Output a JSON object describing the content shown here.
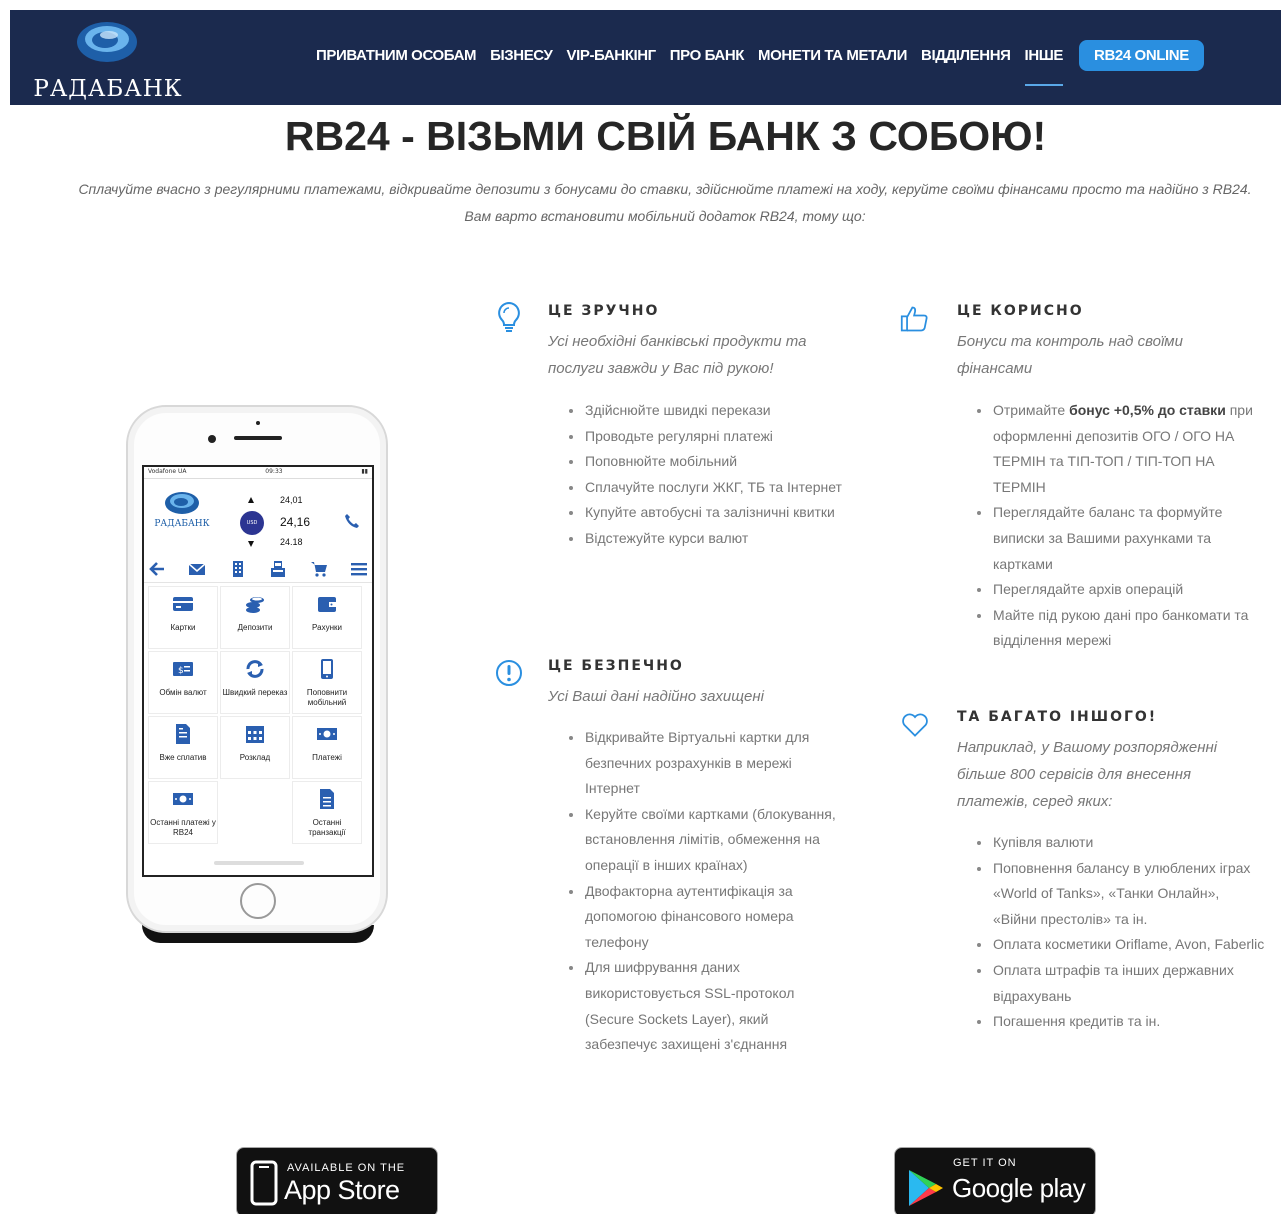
{
  "brand": {
    "name": "РАДАБАНК"
  },
  "nav": {
    "items": [
      {
        "label": "ПРИВАТНИМ ОСОБАМ",
        "name": "nav-private"
      },
      {
        "label": "БІЗНЕСУ",
        "name": "nav-business"
      },
      {
        "label": "VIP-БАНКІНГ",
        "name": "nav-vip"
      },
      {
        "label": "ПРО БАНК",
        "name": "nav-about"
      },
      {
        "label": "МОНЕТИ ТА МЕТАЛИ",
        "name": "nav-coins"
      },
      {
        "label": "ВІДДІЛЕННЯ",
        "name": "nav-branches"
      },
      {
        "label": "ІНШЕ",
        "name": "nav-other",
        "active": true
      }
    ],
    "cta_label": "RB24 ONLINE"
  },
  "hero": {
    "title": "RB24 - ВІЗЬМИ СВІЙ БАНК З СОБОЮ!",
    "subtitle": "Сплачуйте вчасно з регулярними платежами, відкривайте депозити з бонусами до ставки, здійснюйте платежі на ходу, керуйте своїми фінансами просто та надійно з RB24. Вам варто встановити мобільний додаток RB24, тому що:"
  },
  "phone": {
    "status_carrier": "Vodafone UA",
    "status_time": "09:33",
    "brand": "РАДАБАНК",
    "currency": "USD",
    "rate_buy": "24,01",
    "rate_main": "24,16",
    "rate_sell": "24.18",
    "tiles": [
      "Картки",
      "Депозити",
      "Рахунки",
      "Обмін валют",
      "Швидкий переказ",
      "Поповнити мобільний",
      "Вже сплатив",
      "Розклад",
      "Платежі",
      "Останні платежі у RB24",
      "",
      "Останні транзакції"
    ]
  },
  "features": {
    "convenient": {
      "title": "ЦЕ ЗРУЧНО",
      "lead": "Усі необхідні банківські продукти та послуги завжди у Вас під рукою!",
      "items": [
        "Здійснюйте швидкі перекази",
        "Проводьте регулярні платежі",
        "Поповнюйте мобільний",
        "Сплачуйте послуги ЖКГ, ТБ та Інтернет",
        "Купуйте автобусні та залізничні квитки",
        "Відстежуйте курси валют"
      ]
    },
    "useful": {
      "title": "ЦЕ КОРИСНО",
      "lead": "Бонуси та контроль над своїми фінансами",
      "item0_pre": "Отримайте ",
      "item0_bold": "бонус +0,5% до ставки",
      "item0_post": " при оформленні депозитів ОГО / ОГО НА ТЕРМІН та ТІП-ТОП / ТІП-ТОП НА ТЕРМІН",
      "items": [
        "Переглядайте баланс та формуйте виписки за Вашими рахунками та картками",
        "Переглядайте архів операцій",
        "Майте під рукою дані про банкомати та відділення мережі"
      ]
    },
    "secure": {
      "title": "ЦЕ БЕЗПЕЧНО",
      "lead": "Усі Ваші дані надійно захищені",
      "items": [
        "Відкривайте Віртуальні картки для безпечних розрахунків в мережі Інтернет",
        "Керуйте своїми картками (блокування, встановлення лімітів, обмеження на операції в інших країнах)",
        "Двофакторна аутентифікація за допомогою фінансового номера телефону",
        "Для шифрування даних використовується SSL-протокол (Secure Sockets Layer), який забезпечує захищені з'єднання"
      ]
    },
    "more": {
      "title": "ТА БАГАТО ІНШОГО!",
      "lead": "Наприклад, у Вашому розпорядженні більше 800 сервісів для внесення платежів, серед яких:",
      "items": [
        "Купівля валюти",
        "Поповнення балансу в улюблених іграх «World of Tanks», «Танки Онлайн», «Війни престолів» та ін.",
        "Оплата косметики Oriflame, Avon, Faberlic",
        "Оплата штрафів та інших державних відрахувань",
        "Погашення кредитів та ін."
      ]
    }
  },
  "stores": {
    "apple_small": "AVAILABLE ON THE",
    "apple_big": "App Store",
    "google_small": "GET IT ON",
    "google_big": "Google play"
  },
  "colors": {
    "header_bg": "#1b2a4e",
    "accent": "#2a8fe0",
    "icon_blue": "#2a5fb0"
  }
}
